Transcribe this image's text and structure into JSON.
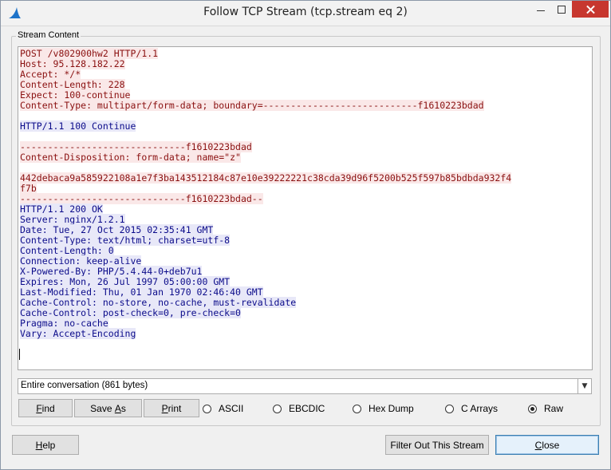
{
  "window": {
    "title": "Follow TCP Stream (tcp.stream eq 2)"
  },
  "group": {
    "label": "Stream Content"
  },
  "stream": {
    "client_head": [
      "POST /v802900hw2 HTTP/1.1",
      "Host: 95.128.182.22",
      "Accept: */*",
      "Content-Length: 228",
      "Expect: 100-continue",
      "Content-Type: multipart/form-data; boundary=----------------------------f1610223bdad"
    ],
    "server_continue": "HTTP/1.1 100 Continue",
    "client_body": [
      "------------------------------f1610223bdad",
      "Content-Disposition: form-data; name=\"z\""
    ],
    "client_data": [
      "442debaca9a585922108a1e7f3ba143512184c87e10e39222221c38cda39d96f5200b525f597b85bdbda932f4",
      "f7b",
      "------------------------------f1610223bdad--"
    ],
    "server_response": [
      "HTTP/1.1 200 OK",
      "Server: nginx/1.2.1",
      "Date: Tue, 27 Oct 2015 02:35:41 GMT",
      "Content-Type: text/html; charset=utf-8",
      "Content-Length: 0",
      "Connection: keep-alive",
      "X-Powered-By: PHP/5.4.44-0+deb7u1",
      "Expires: Mon, 26 Jul 1997 05:00:00 GMT",
      "Last-Modified: Thu, 01 Jan 1970 02:46:40 GMT",
      "Cache-Control: no-store, no-cache, must-revalidate",
      "Cache-Control: post-check=0, pre-check=0",
      "Pragma: no-cache",
      "Vary: Accept-Encoding"
    ]
  },
  "conversation": {
    "selected": "Entire conversation (861 bytes)"
  },
  "buttons": {
    "find": {
      "accel": "F",
      "rest": "ind"
    },
    "save_as": {
      "pre": "Save ",
      "accel": "A",
      "rest": "s"
    },
    "print": {
      "accel": "P",
      "rest": "rint"
    },
    "help": {
      "accel": "H",
      "rest": "elp"
    },
    "filter_out": "Filter Out This Stream",
    "close": {
      "accel": "C",
      "rest": "lose"
    }
  },
  "formats": {
    "options": [
      "ASCII",
      "EBCDIC",
      "Hex Dump",
      "C Arrays",
      "Raw"
    ],
    "selected": "Raw"
  },
  "colors": {
    "client_text": "#8a1010",
    "client_bg": "#fae8e8",
    "server_text": "#0b0b8a",
    "server_bg": "#e8e8f8",
    "close_button": "#c7372f"
  }
}
